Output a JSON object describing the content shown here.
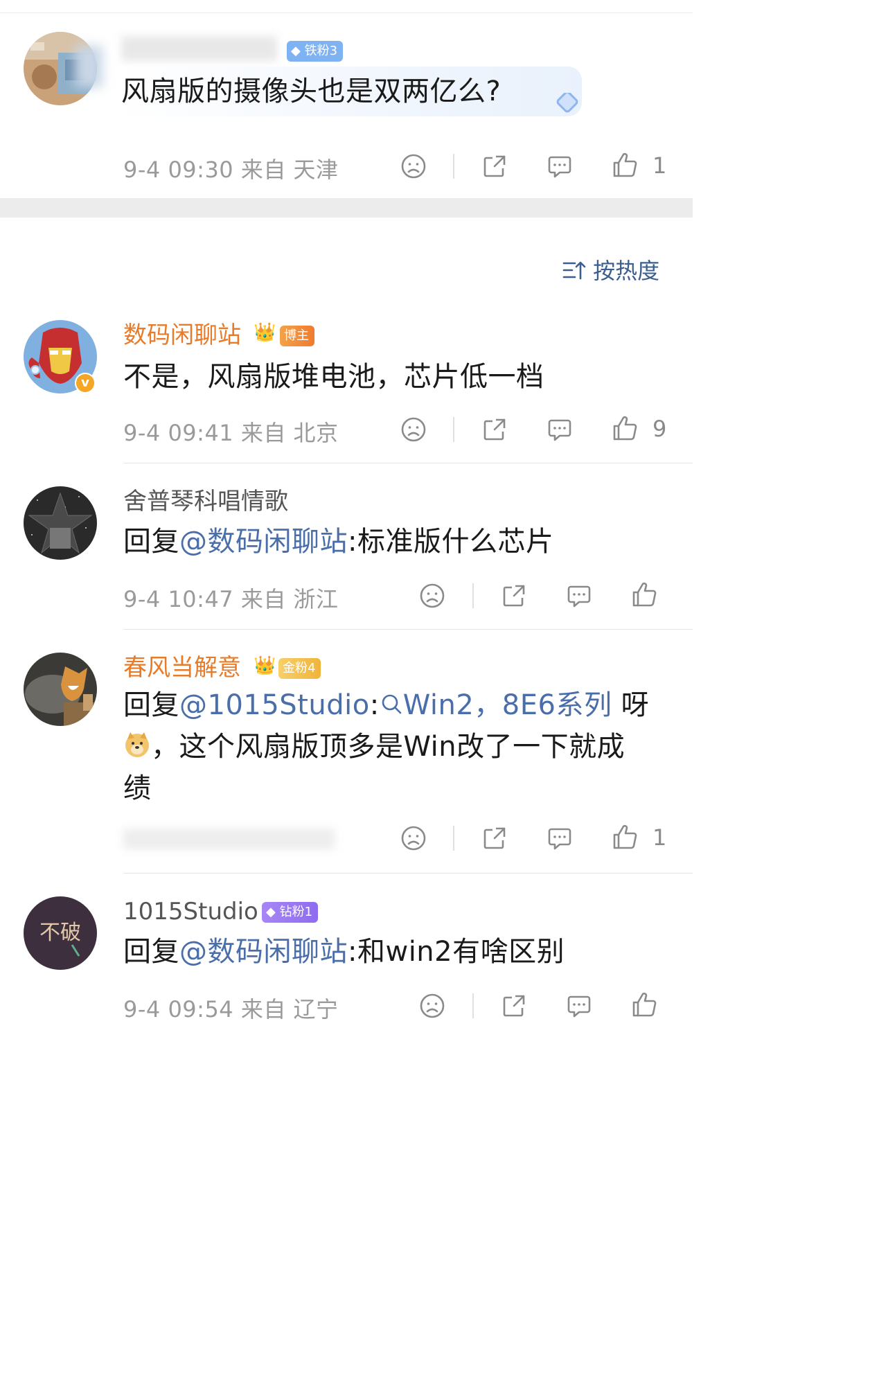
{
  "sort": {
    "label": "按热度"
  },
  "comments": [
    {
      "badge": "铁粉3",
      "text": "风扇版的摄像头也是双两亿么?",
      "time": "9-4 09:30",
      "location": "来自 天津",
      "likes": "1"
    },
    {
      "user": "数码闲聊站",
      "badge": "博主",
      "text": "不是，风扇版堆电池，芯片低一档",
      "time": "9-4 09:41",
      "location": "来自 北京",
      "likes": "9"
    },
    {
      "user": "舍普琴科唱情歌",
      "reply_prefix": "回复",
      "reply_to": "@数码闲聊站",
      "text": ":标准版什么芯片",
      "time": "9-4 10:47",
      "location": "来自 浙江"
    },
    {
      "user": "春风当解意",
      "badge": "金粉4",
      "reply_prefix": "回复",
      "reply_to": "@1015Studio",
      "text_colon": ":",
      "search_link": "Win2，8E6系列",
      "text_after": "呀",
      "text_line2": "，这个风扇版顶多是Win改了一下就成",
      "text_line3": "绩",
      "likes": "1"
    },
    {
      "user": "1015Studio",
      "badge": "钻粉1",
      "reply_prefix": "回复",
      "reply_to": "@数码闲聊站",
      "text": ":和win2有啥区别",
      "time": "9-4 09:54",
      "location": "来自 辽宁"
    }
  ],
  "colors": {
    "username_vip": "#e77b2a",
    "link": "#4a6ea9",
    "meta": "#9a9a9a",
    "separator_band": "#ececec"
  },
  "icons": [
    "dislike-face-icon",
    "share-icon",
    "comment-icon",
    "like-thumb-icon",
    "sort-icon",
    "search-icon",
    "verified-v-icon",
    "crown-icon",
    "diamond-icon"
  ]
}
